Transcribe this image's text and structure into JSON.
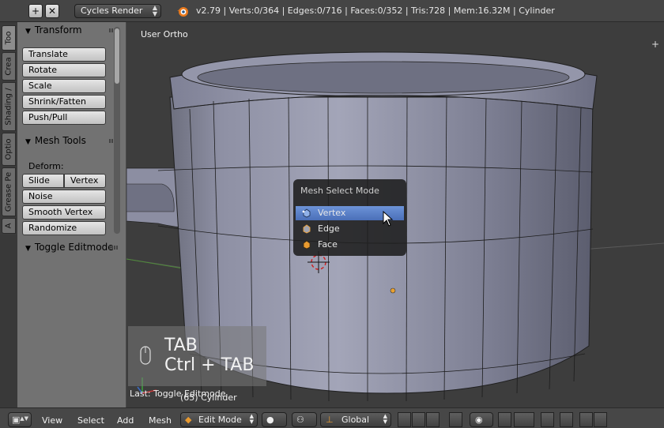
{
  "header": {
    "render_engine": "Cycles Render",
    "stats": "v2.79 | Verts:0/364 | Edges:0/716 | Faces:0/352 | Tris:728 | Mem:16.32M | Cylinder",
    "add_icon": "plus-icon",
    "close_icon": "x-icon"
  },
  "tabs": [
    "Too",
    "Crea",
    "Shading /",
    "Optio",
    "Grease Pe",
    "A"
  ],
  "toolshelf": {
    "transform_title": "Transform",
    "transform_buttons": [
      "Translate",
      "Rotate",
      "Scale",
      "Shrink/Fatten",
      "Push/Pull"
    ],
    "mesh_tools_title": "Mesh Tools",
    "deform_label": "Deform:",
    "slide_edge": "Slide Ed",
    "vertex": "Vertex",
    "noise": "Noise",
    "smooth_vertex": "Smooth Vertex",
    "randomize": "Randomize",
    "toggle_editmode_title": "Toggle Editmode"
  },
  "viewport": {
    "view_label": "User Ortho",
    "popup": {
      "title": "Mesh Select Mode",
      "items": [
        "Vertex",
        "Edge",
        "Face"
      ],
      "selected": "Vertex"
    },
    "key_line1": "TAB",
    "key_line2": "Ctrl + TAB",
    "last_operator": "Last: Toggle Editmode",
    "object_label": "(65) Cylinder"
  },
  "bottombar": {
    "menus": [
      "View",
      "Select",
      "Add",
      "Mesh"
    ],
    "mode": "Edit Mode",
    "orientation": "Global"
  },
  "colors": {
    "accent": "#5a82cc",
    "panel": "#727272",
    "header": "#454545"
  }
}
